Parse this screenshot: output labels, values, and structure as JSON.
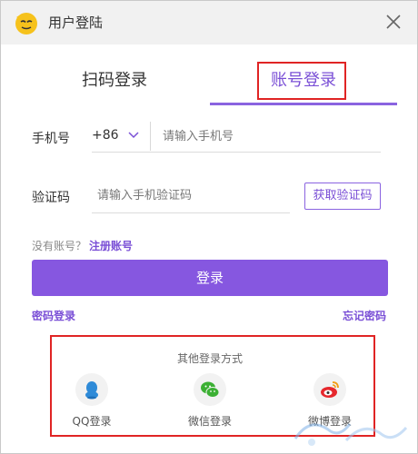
{
  "window": {
    "title": "用户登陆",
    "logo_icon": "smiley-face-logo-icon",
    "close_icon": "close-icon"
  },
  "tabs": [
    {
      "label": "扫码登录",
      "active": false
    },
    {
      "label": "账号登录",
      "active": true
    }
  ],
  "form": {
    "phone_label": "手机号",
    "country_code": "+86",
    "phone_placeholder": "请输入手机号",
    "code_label": "验证码",
    "code_placeholder": "请输入手机验证码",
    "get_code_button": "获取验证码"
  },
  "register": {
    "prompt": "没有账号？",
    "link": "注册账号"
  },
  "login_button": "登录",
  "links": {
    "password_login": "密码登录",
    "forgot_password": "忘记密码"
  },
  "other_login": {
    "title": "其他登录方式",
    "methods": [
      {
        "label": "QQ登录",
        "icon": "qq-penguin-icon"
      },
      {
        "label": "微信登录",
        "icon": "wechat-icon"
      },
      {
        "label": "微博登录",
        "icon": "weibo-icon"
      }
    ]
  },
  "colors": {
    "accent": "#8657e0",
    "highlight_box": "#e02424",
    "titlebar": "#f1f1f1"
  }
}
